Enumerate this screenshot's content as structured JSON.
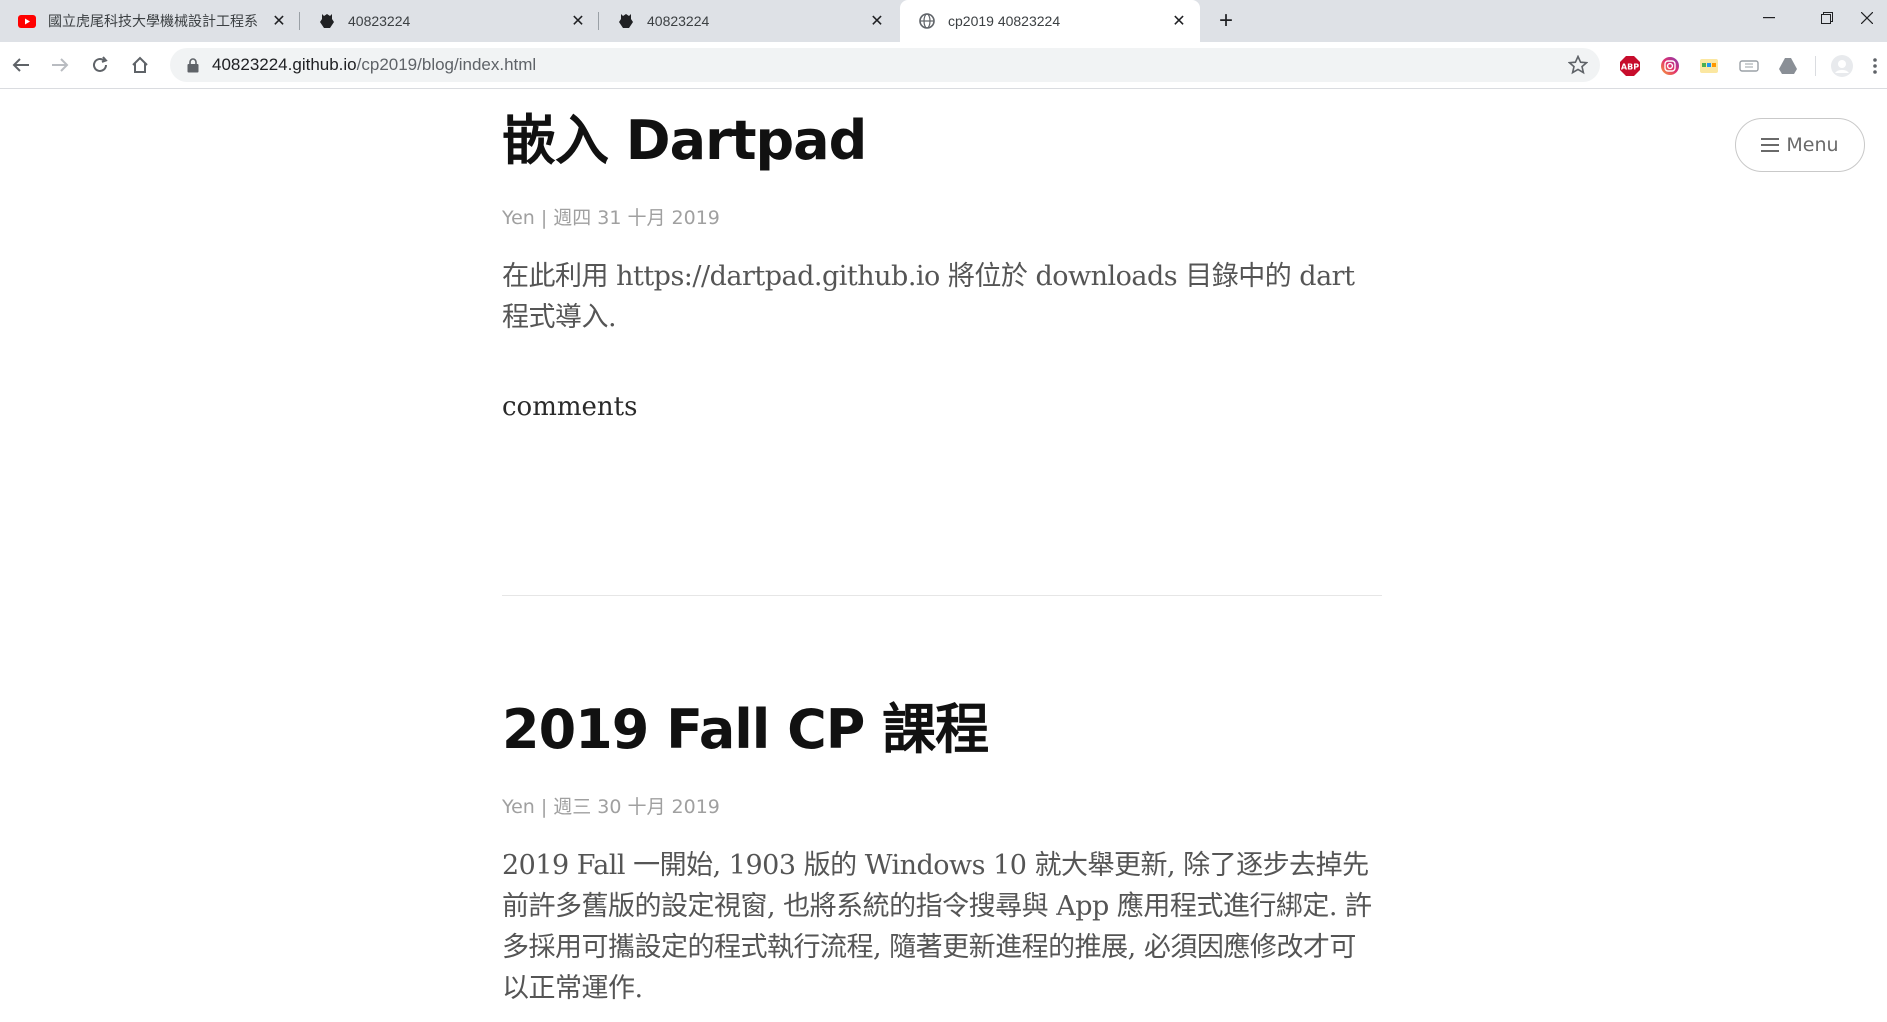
{
  "browser": {
    "tabs": [
      {
        "title": "國立虎尾科技大學機械設計工程系",
        "icon": "youtube-icon",
        "active": false
      },
      {
        "title": "40823224",
        "icon": "github-octocat-icon",
        "active": false
      },
      {
        "title": "40823224",
        "icon": "github-octocat-icon",
        "active": false
      },
      {
        "title": "cp2019 40823224",
        "icon": "globe-icon",
        "active": true
      }
    ],
    "close_glyph": "✕",
    "new_tab_glyph": "+",
    "window_controls": {
      "minimize": "—",
      "restore": "❐",
      "close": "✕"
    },
    "url_host": "40823224.github.io",
    "url_path": "/cp2019/blog/index.html",
    "extensions": [
      "adblock-plus-icon",
      "instagram-extension-icon",
      "smart-extension-icon",
      "ticket-extension-icon",
      "drive-extension-icon",
      "profile-avatar-icon",
      "more-menu-icon"
    ],
    "extension_labels": {
      "abp": "ABP"
    }
  },
  "page": {
    "menu_label": "Menu",
    "posts": [
      {
        "title": "嵌入 Dartpad",
        "author": "Yen",
        "date": "週四 31 十月 2019",
        "excerpt": "在此利用 https://dartpad.github.io 將位於 downloads 目錄中的 dart 程式導入."
      },
      {
        "title": "2019 Fall CP 課程",
        "author": "Yen",
        "date": "週三 30 十月 2019",
        "excerpt": "2019 Fall 一開始, 1903 版的 Windows 10 就大舉更新, 除了逐步去掉先前許多舊版的設定視窗, 也將系統的指令搜尋與 App 應用程式進行綁定. 許多採用可攜設定的程式執行流程, 隨著更新進程的推展, 必須因應修改才可以正常運作."
      }
    ],
    "comments_label": "comments",
    "meta_separator": "|"
  }
}
